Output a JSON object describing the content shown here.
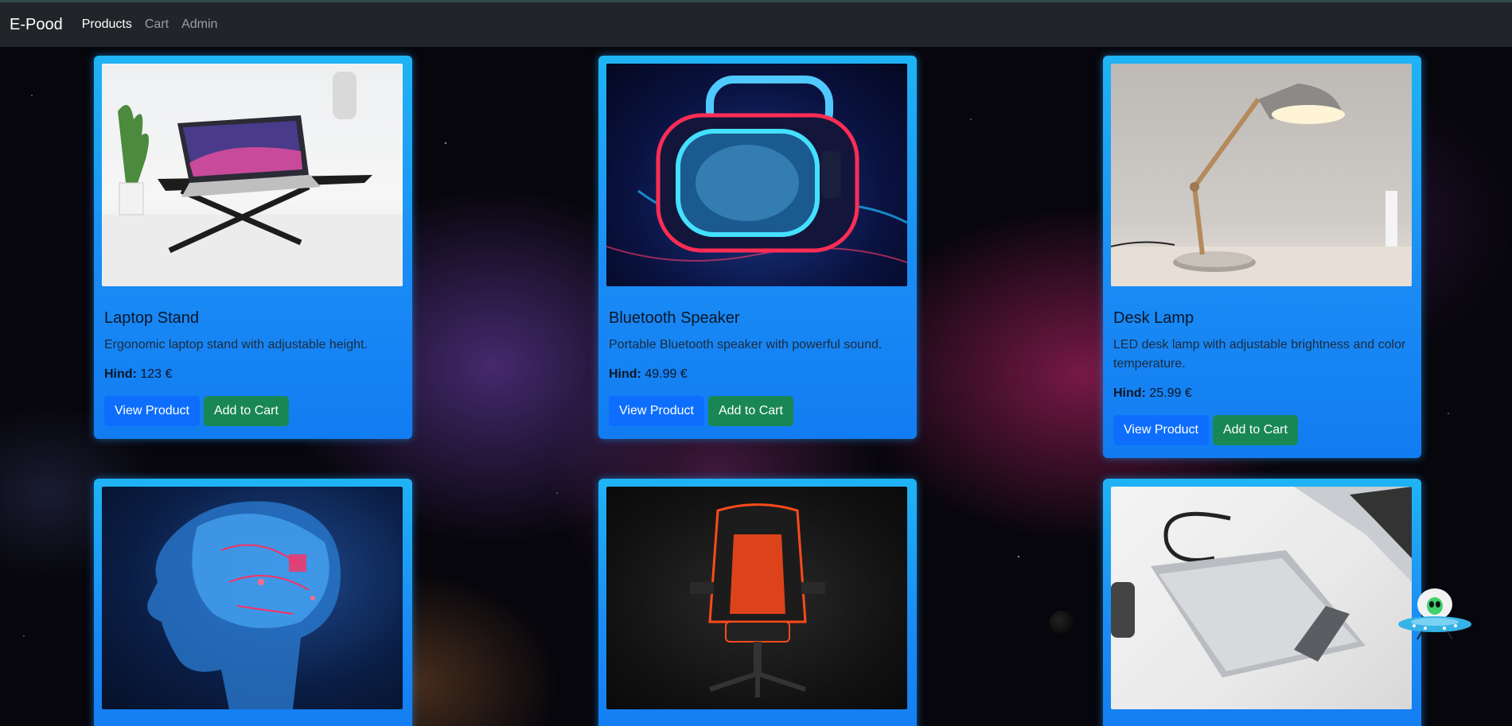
{
  "navbar": {
    "brand": "E-Pood",
    "links": [
      {
        "label": "Products",
        "active": true
      },
      {
        "label": "Cart",
        "active": false
      },
      {
        "label": "Admin",
        "active": false
      }
    ]
  },
  "products": [
    {
      "title": "Laptop Stand",
      "description": "Ergonomic laptop stand with adjustable height.",
      "price_label": "Hind:",
      "price": "123 €",
      "image": "laptop-stand-image"
    },
    {
      "title": "Bluetooth Speaker",
      "description": "Portable Bluetooth speaker with powerful sound.",
      "price_label": "Hind:",
      "price": "49.99 €",
      "image": "bluetooth-speaker-image"
    },
    {
      "title": "Desk Lamp",
      "description": "LED desk lamp with adjustable brightness and color temperature.",
      "price_label": "Hind:",
      "price": "25.99 €",
      "image": "desk-lamp-image"
    },
    {
      "image": "ai-brain-image"
    },
    {
      "image": "gaming-chair-image"
    },
    {
      "image": "external-hard-drive-image"
    }
  ],
  "buttons": {
    "view": "View Product",
    "add": "Add to Cart"
  },
  "colors": {
    "navbar": "#212529",
    "card": "#1a8cf5",
    "primary": "#0d6efd",
    "success": "#198754"
  }
}
